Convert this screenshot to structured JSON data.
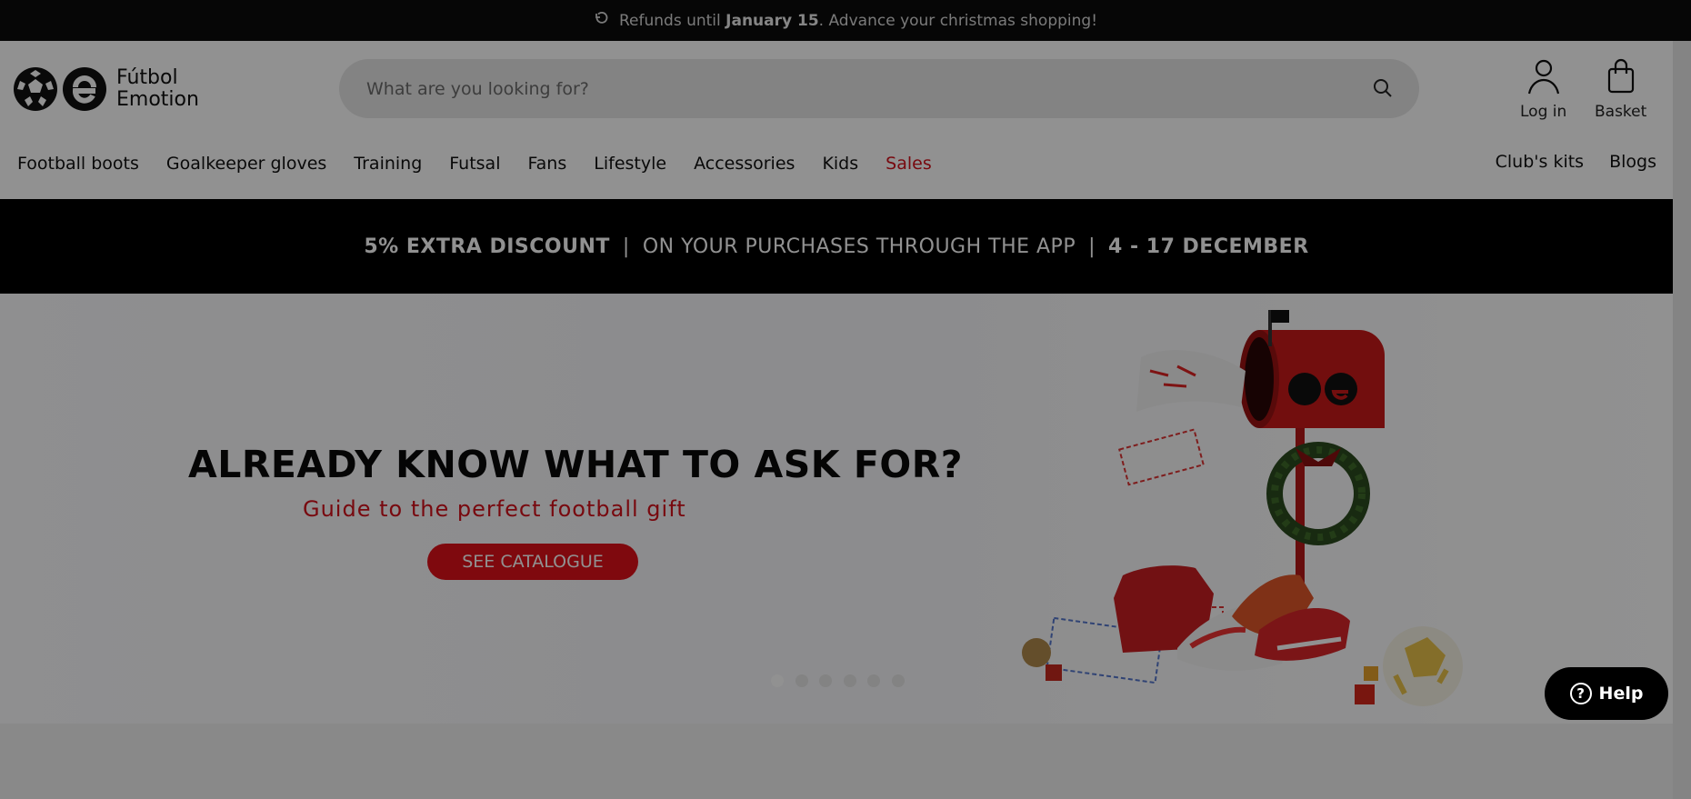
{
  "topbar": {
    "icon": "refresh-icon",
    "text_before": "Refunds until ",
    "text_bold": "January 15",
    "text_after": ". Advance your christmas shopping!"
  },
  "brand": {
    "line1": "Fútbol",
    "line2": "Emotion"
  },
  "search": {
    "placeholder": "What are you looking for?",
    "icon": "search-icon"
  },
  "header_actions": {
    "login_label": "Log in",
    "basket_label": "Basket"
  },
  "nav": {
    "items": [
      {
        "label": "Football boots"
      },
      {
        "label": "Goalkeeper gloves"
      },
      {
        "label": "Training"
      },
      {
        "label": "Futsal"
      },
      {
        "label": "Fans"
      },
      {
        "label": "Lifestyle"
      },
      {
        "label": "Accessories"
      },
      {
        "label": "Kids"
      },
      {
        "label": "Sales"
      }
    ],
    "right_items": [
      {
        "label": "Club's kits"
      },
      {
        "label": "Blogs"
      }
    ]
  },
  "promo": {
    "part1": "5% EXTRA DISCOUNT",
    "sep": "|",
    "part2": "ON YOUR PURCHASES THROUGH THE APP",
    "part3": "4 - 17 DECEMBER"
  },
  "hero": {
    "title": "ALREADY KNOW WHAT TO ASK FOR?",
    "subtitle": "Guide to the perfect football gift",
    "cta": "SEE CATALOGUE",
    "slides_count": 6,
    "active_slide": 1
  },
  "help": {
    "label": "Help",
    "icon": "question-icon"
  },
  "colors": {
    "accent_red": "#d3111b",
    "dark": "#0c0c0c"
  }
}
